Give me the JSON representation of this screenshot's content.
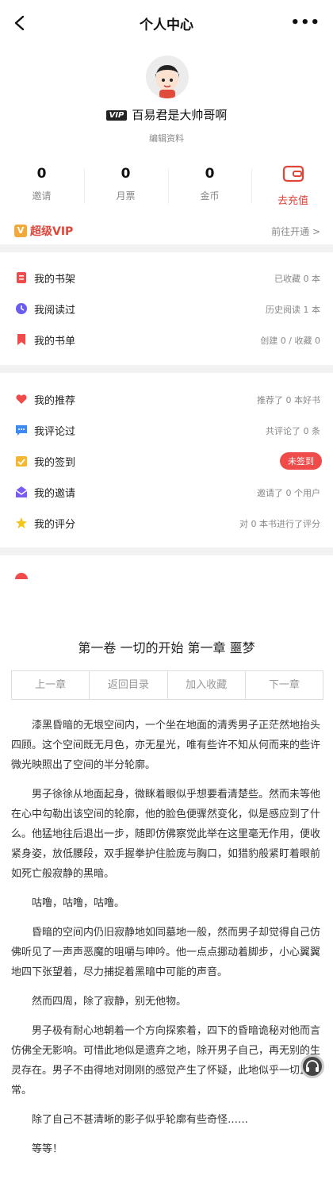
{
  "header": {
    "title": "个人中心",
    "more": "•••"
  },
  "profile": {
    "vip_chip": "VIP",
    "name": "百易君是大帅哥啊",
    "edit": "编辑资料"
  },
  "stats": [
    {
      "num": "0",
      "label": "邀请"
    },
    {
      "num": "0",
      "label": "月票"
    },
    {
      "num": "0",
      "label": "金币"
    }
  ],
  "recharge": {
    "label": "去充值"
  },
  "svip": {
    "badge": "V",
    "label": "超级VIP",
    "action": "前往开通 >"
  },
  "group1": [
    {
      "label": "我的书架",
      "info": "已收藏 0 本"
    },
    {
      "label": "我阅读过",
      "info": "历史阅读 1 本"
    },
    {
      "label": "我的书单",
      "info": "创建 0 / 收藏 0"
    }
  ],
  "group2": [
    {
      "label": "我的推荐",
      "info": "推荐了 0 本好书"
    },
    {
      "label": "我评论过",
      "info": "共评论了 0 条"
    },
    {
      "label": "我的签到",
      "info": "未签到"
    },
    {
      "label": "我的邀请",
      "info": "邀请了 0 个用户"
    },
    {
      "label": "我的评分",
      "info": "对 0 本书进行了评分"
    }
  ],
  "colors": {
    "accent": "#e0453a",
    "pill": "#ef4b4b"
  },
  "reader": {
    "title": "第一卷 一切的开始 第一章 噩梦",
    "nav": [
      "上一章",
      "返回目录",
      "加入收藏",
      "下一章"
    ],
    "paragraphs": [
      "漆黑昏暗的无垠空间内，一个坐在地面的清秀男子正茫然地抬头四顾。这个空间既无月色，亦无星光，唯有些许不知从何而来的些许微光映照出了空间的半分轮廓。",
      "男子徐徐从地面起身，微眯着眼似乎想要看清楚些。然而未等他在心中勾勒出该空间的轮廓，他的脸色便骤然变化，似是感应到了什么。他猛地往后退出一步，随即仿佛察觉此举在这里毫无作用，便收紧身姿，放低腰段，双手握拳护住脸庞与胸口，如猎豹般紧盯着眼前如死亡般寂静的黑暗。",
      "咕噜，咕噜，咕噜。",
      "昏暗的空间内仍旧寂静地如同墓地一般，然而男子却觉得自己仿佛听见了一声声恶魔的咀嚼与呻吟。他一点点挪动着脚步，小心翼翼地四下张望着，尽力捕捉着黑暗中可能的声音。",
      "然而四周，除了寂静，别无他物。",
      "男子极有耐心地朝着一个方向探索着，四下的昏暗诡秘对他而言仿佛全无影响。可惜此地似是遗弃之地，除开男子自己，再无别的生灵存在。男子不由得地对刚刚的感觉产生了怀疑，此地似乎一切正常。",
      "除了自己不甚清晰的影子似乎轮廓有些奇怪……",
      "等等！"
    ]
  }
}
